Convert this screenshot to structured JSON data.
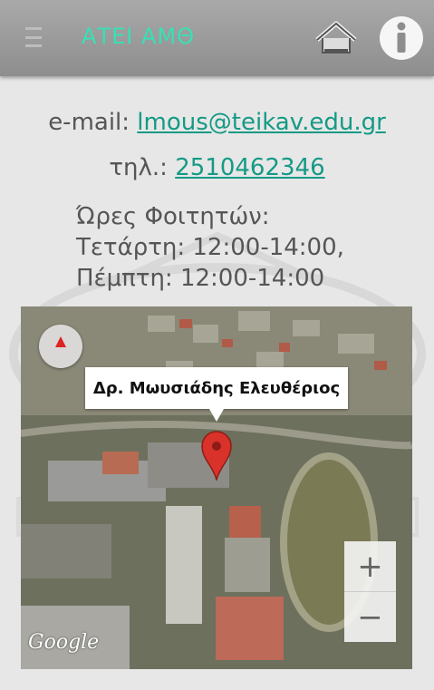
{
  "appbar": {
    "title": "ΑΤΕΙ ΑΜΘ",
    "menu_icon": "menu-icon",
    "home_icon": "home-icon",
    "info_icon": "info-icon"
  },
  "contact": {
    "email_label": "e-mail: ",
    "email": "lmous@teikav.edu.gr",
    "phone_label": "τηλ.: ",
    "phone": "2510462346",
    "hours_title": "Ώρες Φοιτητών:",
    "hours_line1": "Τετάρτη: 12:00-14:00,",
    "hours_line2": "Πέμπτη: 12:00-14:00"
  },
  "map": {
    "marker_label": "Δρ. Μωυσιάδης Ελευθέριος",
    "zoom_in": "+",
    "zoom_out": "−",
    "attribution": "Google"
  },
  "colors": {
    "accent": "#38e0b5",
    "link": "#159a86",
    "appbar": "#9a9a9a",
    "background": "#e7e7e7",
    "pin": "#d8322a"
  }
}
